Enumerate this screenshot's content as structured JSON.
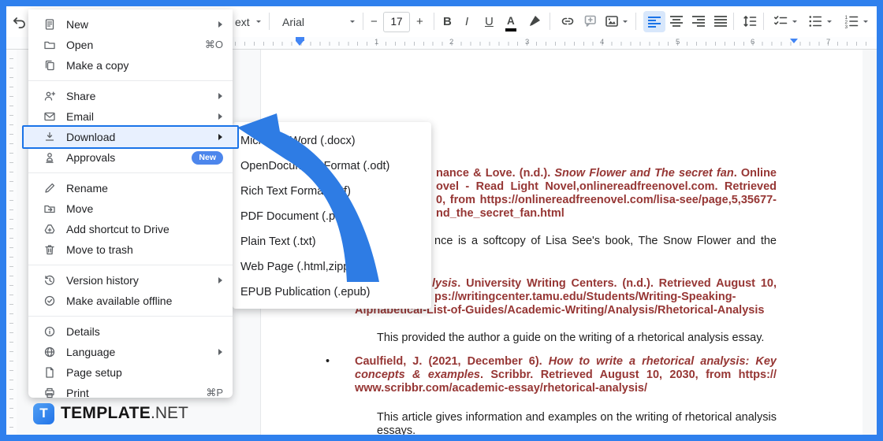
{
  "app": {
    "name": "google-docs-file-menu"
  },
  "colors": {
    "frame_border": "#2f80ed",
    "accent": "#1a73e8",
    "highlight_fill": "#e8f0fe",
    "citation_text": "#963634",
    "annotation_arrow": "#2e7ce4",
    "badge": "#4d86ec",
    "active_button_bg": "#d8e7fb"
  },
  "toolbar": {
    "paragraph_style_partial": "ext",
    "font_name": "Arial",
    "font_size": "17",
    "minus": "−",
    "plus": "+",
    "bold": "B",
    "italic": "I",
    "underline": "U",
    "text_color": "A"
  },
  "ruler": {
    "numbers": [
      "1",
      "2",
      "3",
      "4",
      "5",
      "6",
      "7"
    ]
  },
  "menu": {
    "items": [
      {
        "icon": "new-document-icon",
        "label": "New",
        "submenu": true
      },
      {
        "icon": "folder-open-icon",
        "label": "Open",
        "shortcut": "⌘O"
      },
      {
        "icon": "copy-icon",
        "label": "Make a copy"
      },
      {
        "icon": "person-add-icon",
        "label": "Share",
        "submenu": true
      },
      {
        "icon": "envelope-icon",
        "label": "Email",
        "submenu": true
      },
      {
        "icon": "download-icon",
        "label": "Download",
        "submenu": true,
        "highlighted": true
      },
      {
        "icon": "approval-icon",
        "label": "Approvals",
        "badge": "New"
      },
      {
        "icon": "pencil-icon",
        "label": "Rename"
      },
      {
        "icon": "folder-move-icon",
        "label": "Move"
      },
      {
        "icon": "drive-add-icon",
        "label": "Add shortcut to Drive"
      },
      {
        "icon": "trash-icon",
        "label": "Move to trash"
      },
      {
        "icon": "history-icon",
        "label": "Version history",
        "submenu": true
      },
      {
        "icon": "offline-check-icon",
        "label": "Make available offline"
      },
      {
        "icon": "info-icon",
        "label": "Details"
      },
      {
        "icon": "globe-icon",
        "label": "Language",
        "submenu": true
      },
      {
        "icon": "page-icon",
        "label": "Page setup"
      },
      {
        "icon": "printer-icon",
        "label": "Print",
        "shortcut": "⌘P"
      }
    ]
  },
  "submenu": {
    "items": [
      "Microsoft Word (.docx)",
      "OpenDocument Format (.odt)",
      "Rich Text Format (.rtf)",
      "PDF Document (.pdf)",
      "Plain Text (.txt)",
      "Web Page (.html,zipped)",
      "EPUB Publication (.epub)"
    ]
  },
  "document": {
    "c1": {
      "l1": {
        "pre": "nance & Love. (n.d.). ",
        "em": "Snow Flower and The secret fan",
        "post": ". Online"
      },
      "l2": {
        "pre": "ovel - Read Light Novel,onlinereadfreenovel.com. Retrieved"
      },
      "l3": {
        "pre": "0, from https://onlinereadfreenovel.com/lisa-see/page,5,35677-"
      },
      "l4": {
        "pre": "nd_the_secret_fan.html"
      }
    },
    "p1": "nce is a softcopy of Lisa See's book, The Snow Flower and the",
    "c2": {
      "l1": {
        "em": "lysis",
        "post": ". University Writing Centers. (n.d.). Retrieved August 10,"
      },
      "l2": {
        "pre": "ps://writingcenter.tamu.edu/Students/Writing-Speaking-Guides/"
      },
      "l3": {
        "pre": "Alphabetical-List-of-Guides/Academic-Writing/Analysis/Rhetorical-Analysis"
      }
    },
    "p2": "This provided the author a guide on the writing of a rhetorical analysis essay.",
    "bullet": "•",
    "c3": {
      "l1": {
        "pre": "Caulfield, J. (2021, December 6). ",
        "em": "How to write a rhetorical analysis: Key"
      },
      "l2": {
        "em": "concepts & examples",
        "post": ". Scribbr. Retrieved August 10, 2030, from https://"
      },
      "l3": {
        "pre": "www.scribbr.com/academic-essay/rhetorical-analysis/"
      }
    },
    "p3a": "This article gives information and examples on the writing of rhetorical analysis",
    "p3b": "essays."
  },
  "logo": {
    "icon_letter": "T",
    "text_bold": "TEMPLATE",
    "text_light": ".NET"
  }
}
